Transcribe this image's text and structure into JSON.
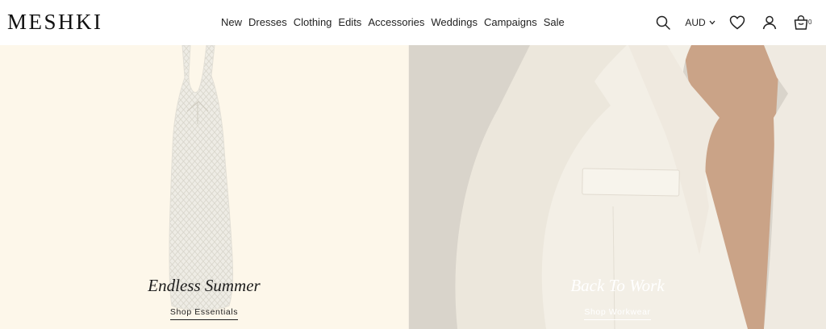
{
  "brand": {
    "name": "MESHKI"
  },
  "nav": {
    "items": [
      {
        "label": "New"
      },
      {
        "label": "Dresses"
      },
      {
        "label": "Clothing"
      },
      {
        "label": "Edits"
      },
      {
        "label": "Accessories"
      },
      {
        "label": "Weddings"
      },
      {
        "label": "Campaigns"
      },
      {
        "label": "Sale"
      }
    ]
  },
  "toolbar": {
    "search_icon": "search-icon",
    "currency": "AUD",
    "wishlist_icon": "heart-icon",
    "account_icon": "user-icon",
    "cart_icon": "bag-icon",
    "cart_count": "0"
  },
  "hero": {
    "left": {
      "title": "Endless Summer",
      "link_label": "Shop Essentials",
      "bg": "#fdf7ea"
    },
    "right": {
      "title": "Back To Work",
      "link_label": "Shop Workwear",
      "bg": "#d8d3cb"
    }
  }
}
